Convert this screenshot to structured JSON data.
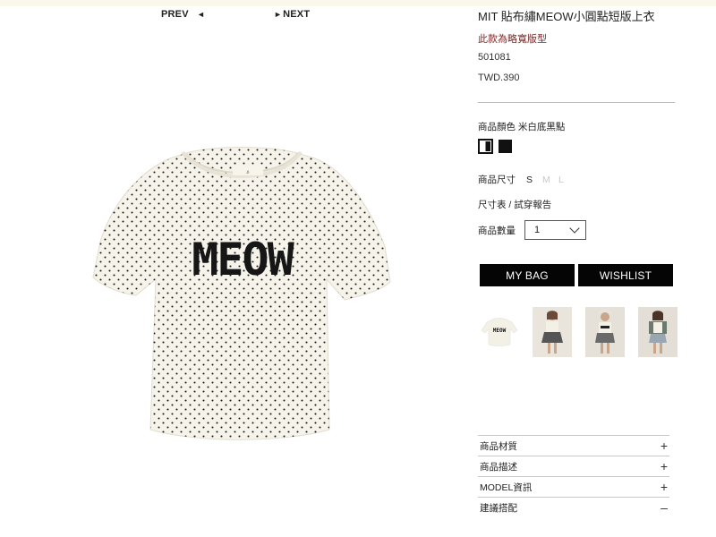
{
  "nav": {
    "prev_label": "PREV",
    "prev_arrow": "◄",
    "next_arrow": "►",
    "next_label": "NEXT"
  },
  "product": {
    "title": "MIT 貼布繡MEOW小圓點短版上衣",
    "fit_note": "此款為略寬版型",
    "sku": "501081",
    "price": "TWD.390",
    "print_text": "MEOW"
  },
  "options": {
    "color_label": "商品顏色",
    "color_value": "米白底黑點",
    "size_label": "商品尺寸",
    "sizes": [
      "S",
      "M",
      "L"
    ],
    "size_chart_link": "尺寸表 / 試穿報告",
    "quantity_label": "商品數量",
    "quantity_value": "1"
  },
  "actions": {
    "bag_label": "MY BAG",
    "wishlist_label": "WISHLIST"
  },
  "thumbnails": {
    "thumb_1_text": "MEOW"
  },
  "accordion": [
    {
      "label": "商品材質",
      "icon": "+"
    },
    {
      "label": "商品描述",
      "icon": "+"
    },
    {
      "label": "MODEL資訊",
      "icon": "+"
    },
    {
      "label": "建議搭配",
      "icon": "–"
    }
  ],
  "colors": {
    "fit_note": "#7a2a2a",
    "button_bg": "#050505",
    "shirt": "#f6f3ea",
    "top_strip": "#fbf7ea"
  }
}
